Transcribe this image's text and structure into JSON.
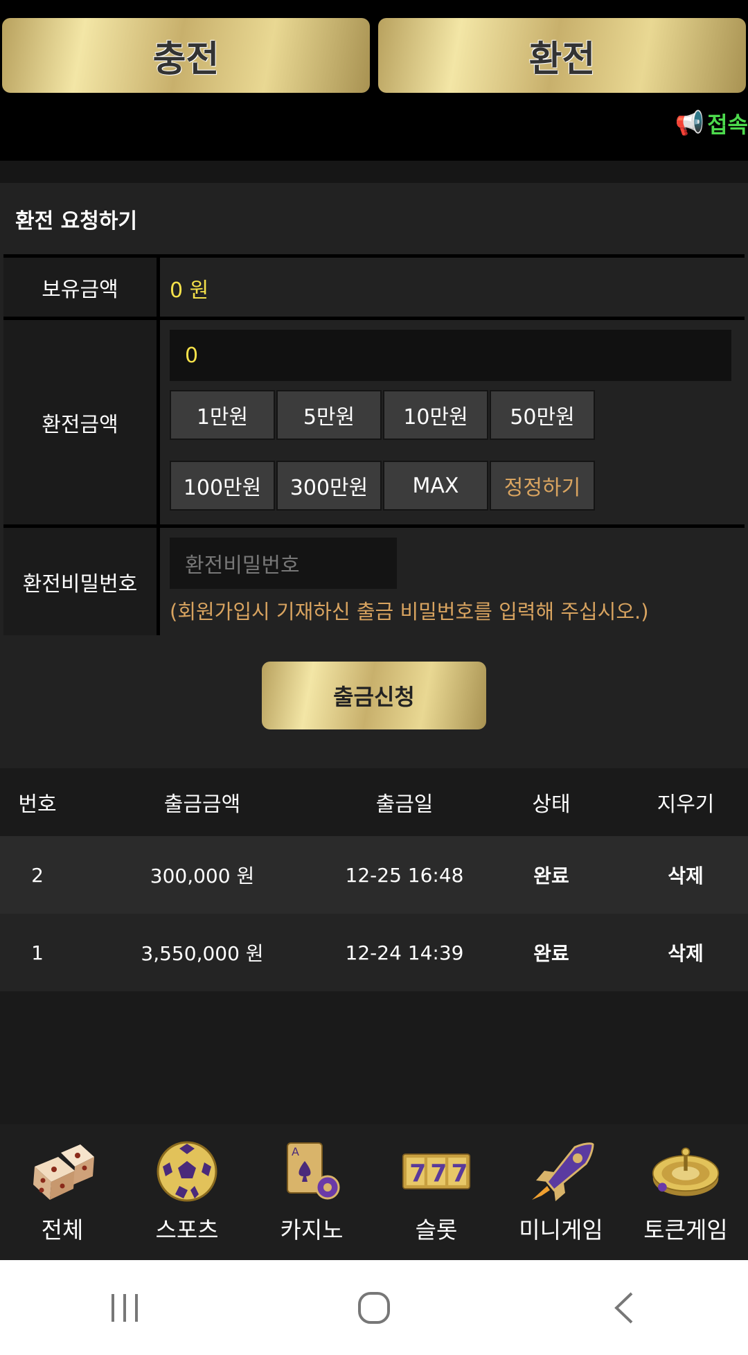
{
  "top_tabs": {
    "charge": "충전",
    "exchange": "환전"
  },
  "notice": {
    "icon": "megaphone-icon",
    "text": "접속"
  },
  "form": {
    "title": "환전 요청하기",
    "balance_label": "보유금액",
    "balance_value": "0 원",
    "amount_label": "환전금액",
    "amount_value": "0",
    "amount_buttons": [
      "1만원",
      "5만원",
      "10만원",
      "50만원",
      "100만원",
      "300만원",
      "MAX",
      "정정하기"
    ],
    "password_label": "환전비밀번호",
    "password_placeholder": "환전비밀번호",
    "password_hint": "(회원가입시 기재하신 출금 비밀번호를 입력해 주십시오.)",
    "submit": "출금신청"
  },
  "history": {
    "headers": [
      "번호",
      "출금금액",
      "출금일",
      "상태",
      "지우기"
    ],
    "rows": [
      {
        "no": "2",
        "amount": "300,000 원",
        "date": "12-25 16:48",
        "status": "완료",
        "delete": "삭제"
      },
      {
        "no": "1",
        "amount": "3,550,000 원",
        "date": "12-24 14:39",
        "status": "완료",
        "delete": "삭제"
      }
    ]
  },
  "bottom_nav": [
    {
      "label": "전체",
      "icon": "dice-icon"
    },
    {
      "label": "스포츠",
      "icon": "soccer-ball-icon"
    },
    {
      "label": "카지노",
      "icon": "playing-cards-icon"
    },
    {
      "label": "슬롯",
      "icon": "slot-777-icon"
    },
    {
      "label": "미니게임",
      "icon": "rocket-icon"
    },
    {
      "label": "토큰게임",
      "icon": "roulette-icon"
    }
  ],
  "colors": {
    "gold": "#e9d893",
    "yellow_value": "#f5e14a",
    "orange_hint": "#d9a460",
    "notice_green": "#4cd94c"
  }
}
